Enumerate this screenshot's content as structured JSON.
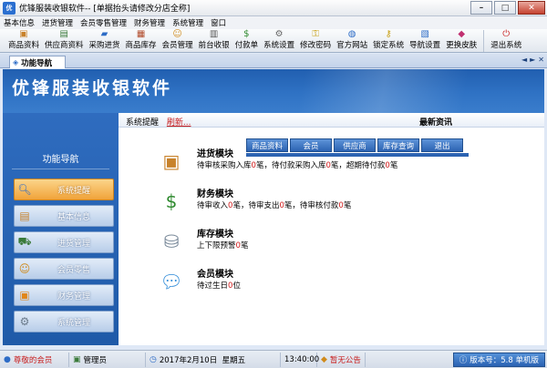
{
  "window": {
    "title": "优锋服装收银软件-- [单据抬头请修改分店全称]",
    "minimize": "–",
    "maximize": "□",
    "close": "✕"
  },
  "menu": [
    "基本信息",
    "进货管理",
    "会员零售管理",
    "财务管理",
    "系统管理",
    "窗口"
  ],
  "toolbar": [
    {
      "label": "商品资料",
      "icon": "box-icon"
    },
    {
      "label": "供应商资料",
      "icon": "supplier-icon"
    },
    {
      "label": "采购进货",
      "icon": "truck-icon"
    },
    {
      "label": "商品库存",
      "icon": "stock-icon"
    },
    {
      "label": "会员管理",
      "icon": "member-icon"
    },
    {
      "label": "前台收银",
      "icon": "cashier-icon"
    },
    {
      "label": "付款单",
      "icon": "payment-icon"
    },
    {
      "label": "系统设置",
      "icon": "gear-icon"
    },
    {
      "label": "修改密码",
      "icon": "key-icon"
    },
    {
      "label": "官方网站",
      "icon": "globe-icon"
    },
    {
      "label": "锁定系统",
      "icon": "lock-icon"
    },
    {
      "label": "导航设置",
      "icon": "nav-icon"
    },
    {
      "label": "更换皮肤",
      "icon": "skin-icon"
    },
    {
      "label": "退出系统",
      "icon": "exit-icon"
    }
  ],
  "tab": {
    "label": "功能导航"
  },
  "tab_nav": [
    "◄",
    "►",
    "✕"
  ],
  "banner": {
    "title": "优锋服装收银软件"
  },
  "sidebar": {
    "header": "功能导航",
    "items": [
      {
        "label": "系统提醒",
        "active": true,
        "icon": "search-icon"
      },
      {
        "label": "基本信息",
        "active": false,
        "icon": "info-icon"
      },
      {
        "label": "进货管理",
        "active": false,
        "icon": "cart-icon"
      },
      {
        "label": "会员零售",
        "active": false,
        "icon": "member-icon"
      },
      {
        "label": "财务管理",
        "active": false,
        "icon": "box-icon"
      },
      {
        "label": "系统管理",
        "active": false,
        "icon": "gear-icon"
      }
    ]
  },
  "info_bar": {
    "reminder": "系统提醒",
    "refresh": "刷新...",
    "news": "最新资讯"
  },
  "quick_buttons": [
    "商品资料",
    "会员",
    "供应商",
    "库存查询",
    "退出"
  ],
  "modules": [
    {
      "title": "进货模块",
      "icon": "package-icon",
      "desc": [
        [
          "待审核采购入库",
          "0",
          "笔，待付款采购入库",
          "0",
          "笔，超期待付款",
          "0",
          "笔"
        ]
      ]
    },
    {
      "title": "财务模块",
      "icon": "money-icon",
      "desc": [
        [
          "待审收入",
          "0",
          "笔，待审支出",
          "0",
          "笔，待审核付款",
          "0",
          "笔"
        ]
      ]
    },
    {
      "title": "库存模块",
      "icon": "database-icon",
      "desc": [
        [
          "上下限预警",
          "0",
          "笔"
        ]
      ]
    },
    {
      "title": "会员模块",
      "icon": "chat-icon",
      "desc": [
        [
          "待过生日",
          "0",
          "位"
        ]
      ]
    }
  ],
  "status": {
    "user_label": "尊敬的会员",
    "role": "管理员",
    "date": "2017年2月10日",
    "weekday": "星期五",
    "time": "13:40:00",
    "notice": "暂无公告",
    "version": "版本号：5.8 单机版"
  }
}
